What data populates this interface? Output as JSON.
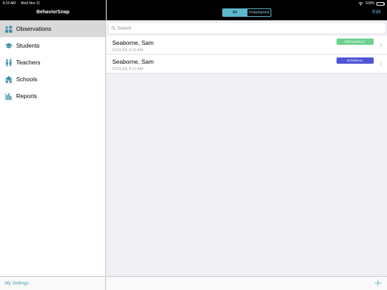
{
  "status_bar": {
    "time": "8:15 AM",
    "date": "Wed Nov 21",
    "battery": "100%"
  },
  "sidebar": {
    "title": "BehaviorSnap",
    "items": [
      {
        "label": "Observations",
        "icon": "shapes-icon",
        "selected": true
      },
      {
        "label": "Students",
        "icon": "graduation-cap-icon",
        "selected": false
      },
      {
        "label": "Teachers",
        "icon": "people-icon",
        "selected": false
      },
      {
        "label": "Schools",
        "icon": "school-icon",
        "selected": false
      },
      {
        "label": "Reports",
        "icon": "bar-chart-icon",
        "selected": false
      }
    ],
    "settings_label": "My Settings"
  },
  "header": {
    "segments": [
      {
        "label": "All",
        "active": true
      },
      {
        "label": "Unassigned",
        "active": false
      }
    ],
    "edit_label": "Edit"
  },
  "search": {
    "placeholder": "Search",
    "value": ""
  },
  "observations": [
    {
      "name": "Seaborne, Sam",
      "timestamp": "11/21/18, 8:15 AM",
      "type": "FREQUENCY",
      "type_color": "#6dd18e"
    },
    {
      "name": "Seaborne, Sam",
      "timestamp": "11/21/18, 8:12 AM",
      "type": "INTERVAL",
      "type_color": "#5055d6"
    }
  ],
  "colors": {
    "accent": "#5eb8cc",
    "selected_row": "#d9d9d9",
    "icon": "#3f8fa6"
  }
}
